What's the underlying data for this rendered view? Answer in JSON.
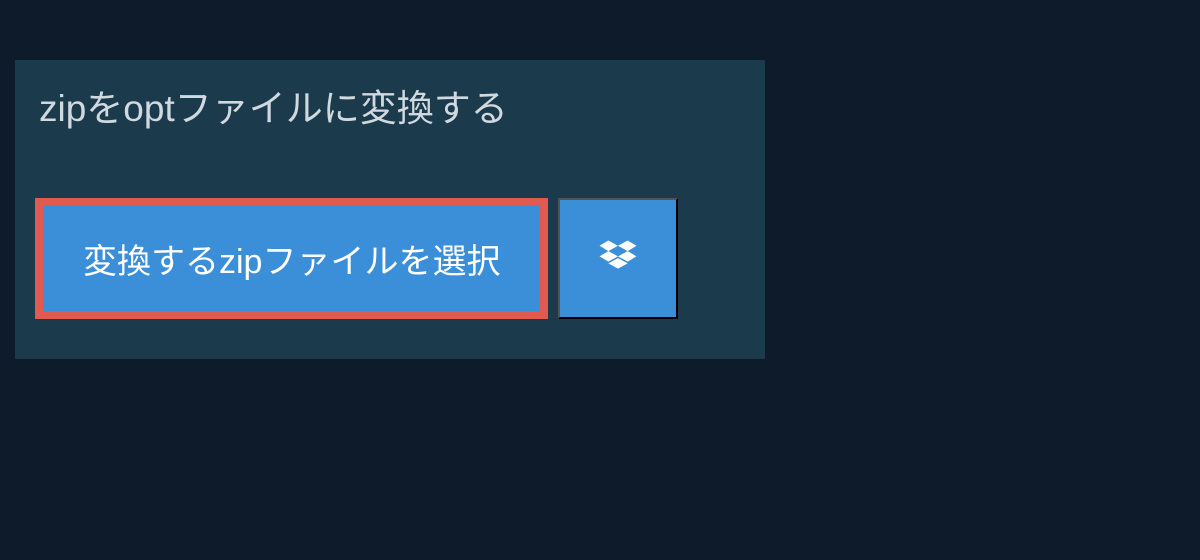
{
  "header": {
    "title": "zipをoptファイルに変換する"
  },
  "actions": {
    "select_file_label": "変換するzipファイルを選択",
    "dropbox_icon": "dropbox-icon"
  },
  "colors": {
    "background": "#0d1b2a",
    "panel": "#1b3a4b",
    "button": "#3b8ed8",
    "highlight_border": "#e05a4f",
    "text_light": "#d0d8e0",
    "text_white": "#ffffff"
  }
}
